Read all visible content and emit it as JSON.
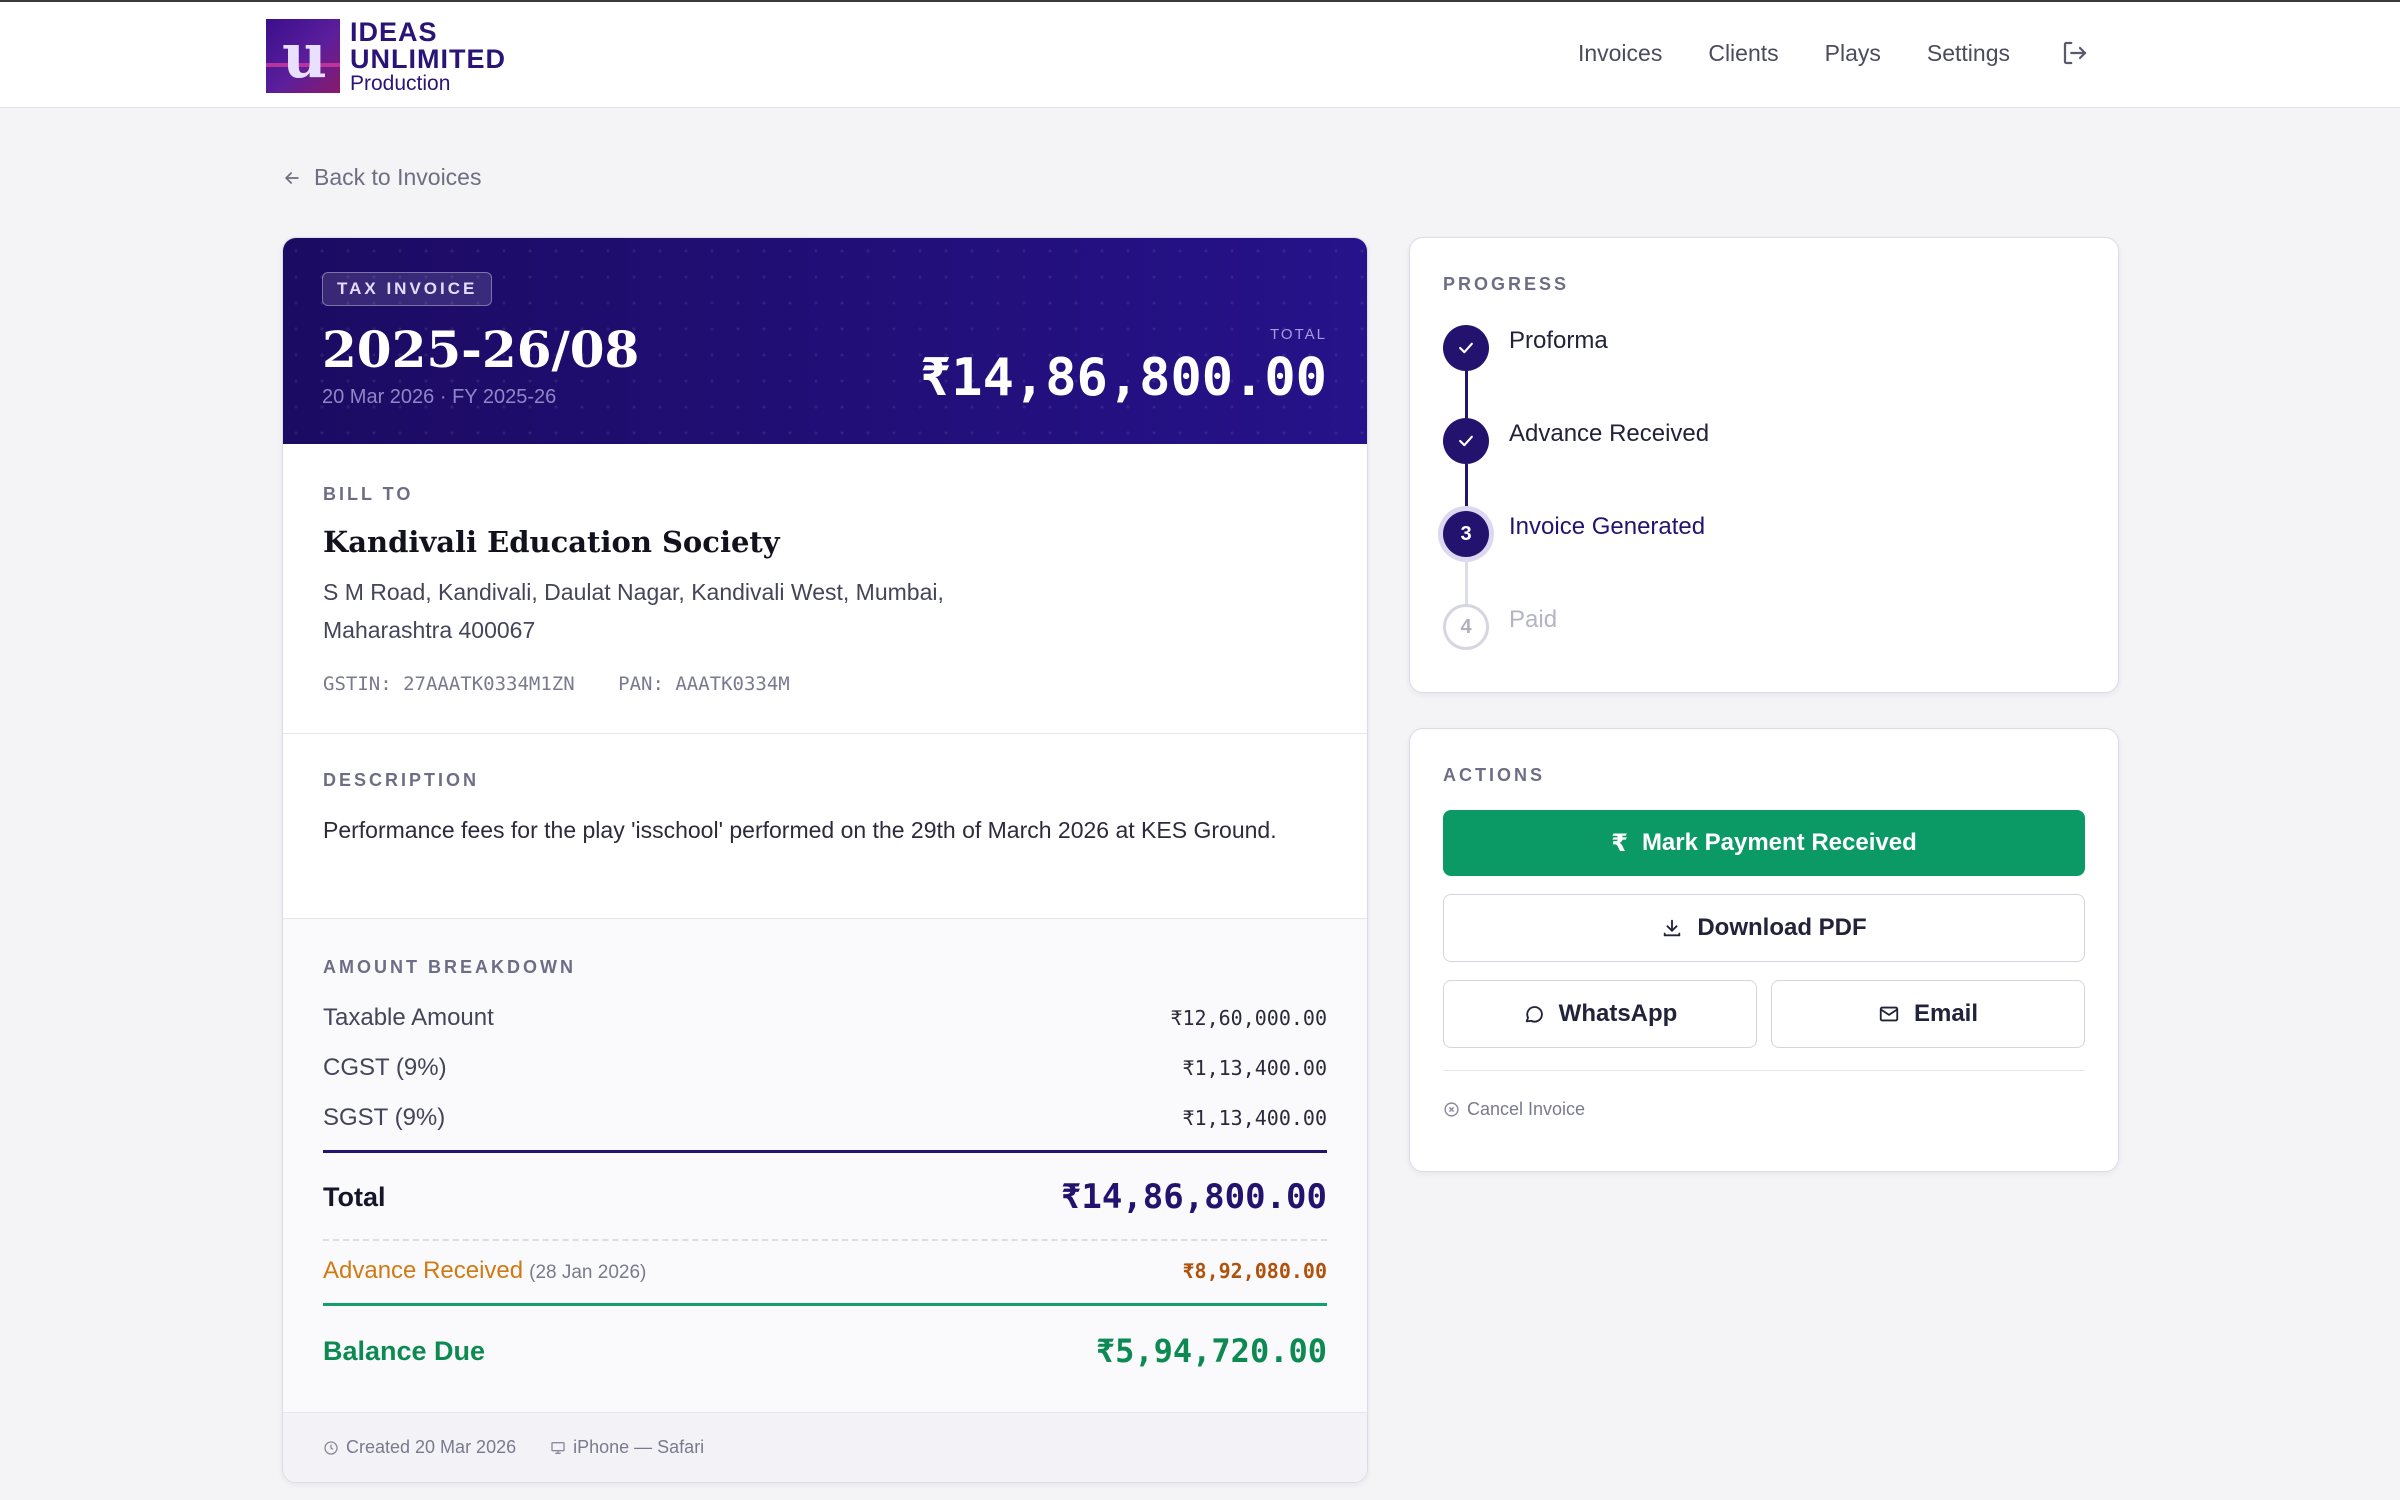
{
  "brand": {
    "line1": "IDEAS",
    "line2": "UNLIMITED",
    "line3": "Production"
  },
  "nav": {
    "items": [
      "Invoices",
      "Clients",
      "Plays",
      "Settings"
    ],
    "logout_icon": "logout-icon"
  },
  "back_link": "Back to Invoices",
  "invoice": {
    "badge": "TAX INVOICE",
    "number": "2025-26/08",
    "date_line": "20 Mar 2026 · FY 2025-26",
    "total_label": "TOTAL",
    "total": "₹14,86,800.00"
  },
  "bill_to": {
    "label": "BILL TO",
    "client": "Kandivali Education Society",
    "address": "S M Road, Kandivali, Daulat Nagar, Kandivali West, Mumbai, Maharashtra 400067",
    "gstin": "GSTIN: 27AAATK0334M1ZN",
    "pan": "PAN: AAATK0334M"
  },
  "description": {
    "label": "DESCRIPTION",
    "text": "Performance fees for the play 'isschool' performed on the 29th of March 2026 at KES Ground."
  },
  "breakdown": {
    "label": "AMOUNT BREAKDOWN",
    "rows": [
      {
        "label": "Taxable Amount",
        "value": "₹12,60,000.00"
      },
      {
        "label": "CGST (9%)",
        "value": "₹1,13,400.00"
      },
      {
        "label": "SGST (9%)",
        "value": "₹1,13,400.00"
      }
    ],
    "total_label": "Total",
    "total_value": "₹14,86,800.00",
    "advance_label": "Advance Received",
    "advance_date": "(28 Jan 2026)",
    "advance_value": "₹8,92,080.00",
    "balance_label": "Balance Due",
    "balance_value": "₹5,94,720.00"
  },
  "footer": {
    "created": "Created 20 Mar 2026",
    "device": "iPhone — Safari"
  },
  "progress": {
    "label": "PROGRESS",
    "steps": [
      {
        "label": "Proforma",
        "state": "done"
      },
      {
        "label": "Advance Received",
        "state": "done"
      },
      {
        "label": "Invoice Generated",
        "state": "current",
        "num": "3"
      },
      {
        "label": "Paid",
        "state": "todo",
        "num": "4"
      }
    ]
  },
  "actions": {
    "label": "ACTIONS",
    "mark_paid": "Mark Payment Received",
    "download": "Download PDF",
    "whatsapp": "WhatsApp",
    "email": "Email",
    "cancel": "Cancel Invoice"
  },
  "colors": {
    "brand": "#24136e",
    "success": "#0b9a66",
    "advance": "#d17a13"
  }
}
